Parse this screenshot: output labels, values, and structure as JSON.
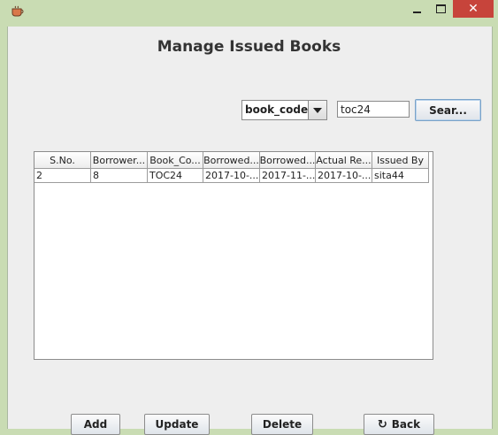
{
  "window": {
    "close_symbol": "✕"
  },
  "title": "Manage Issued Books",
  "search": {
    "field_selected": "book_code",
    "query": "toc24",
    "button_label": "Sear..."
  },
  "table": {
    "headers": [
      "S.No.",
      "Borrower...",
      "Book_Co...",
      "Borrowed...",
      "Borrowed...",
      "Actual Re...",
      "Issued By"
    ],
    "rows": [
      [
        "2",
        "8",
        "TOC24",
        "2017-10-...",
        "2017-11-...",
        "2017-10-...",
        "sita44"
      ]
    ]
  },
  "buttons": {
    "add": "Add",
    "update": "Update",
    "delete": "Delete",
    "back": "Back",
    "back_icon": "refresh-icon"
  }
}
